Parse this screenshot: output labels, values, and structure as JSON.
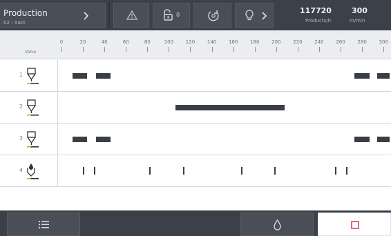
{
  "header": {
    "title": "Production",
    "subtitle": "02 - Xact",
    "chevron_icon": "chevron-right-icon",
    "warning_icon": "warning-triangle-icon",
    "lock_icon": "unlock-icon",
    "lock_count": "0",
    "nozzle_cleaning_icon": "nozzle-cleaning-icon",
    "bulb_icon": "lightbulb-icon",
    "bulb_chevron_icon": "chevron-right-icon",
    "products_rate": "117720",
    "products_rate_unit": "Products/h",
    "speed": "300",
    "speed_unit": "m/min"
  },
  "scale": {
    "label": "Valve",
    "ticks": [
      "0",
      "20",
      "40",
      "60",
      "80",
      "100",
      "120",
      "140",
      "160",
      "180",
      "200",
      "220",
      "240",
      "260",
      "280",
      "300"
    ]
  },
  "valves": [
    {
      "number": "1",
      "icon": "glue-valve-icon",
      "segments": [
        [
          10,
          24
        ],
        [
          32,
          46
        ],
        [
          273,
          287
        ],
        [
          294,
          309
        ]
      ],
      "pulses": []
    },
    {
      "number": "2",
      "icon": "glue-valve-icon",
      "segments": [
        [
          106,
          208
        ]
      ],
      "pulses": []
    },
    {
      "number": "3",
      "icon": "glue-valve-icon",
      "segments": [
        [
          10,
          24
        ],
        [
          32,
          46
        ],
        [
          273,
          287
        ],
        [
          294,
          309
        ]
      ],
      "pulses": []
    },
    {
      "number": "4",
      "icon": "dot-valve-icon",
      "segments": [],
      "pulses": [
        20,
        30,
        82,
        113,
        167,
        198,
        255,
        265
      ]
    }
  ],
  "footer": {
    "list_icon": "list-icon",
    "drop_icon": "drop-icon",
    "stop_icon": "stop-square-icon",
    "stop_color": "#e0334a"
  }
}
